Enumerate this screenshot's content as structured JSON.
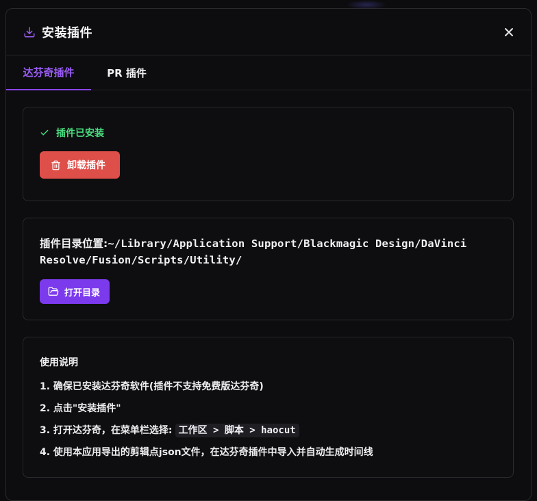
{
  "dialog": {
    "title": "安装插件",
    "title_icon": "download-icon",
    "close_icon": "close-icon"
  },
  "tabs": [
    {
      "label": "达芬奇插件",
      "active": true
    },
    {
      "label": "PR 插件",
      "active": false
    }
  ],
  "status": {
    "text": "插件已安装",
    "icon": "check-icon",
    "color": "#4ade80"
  },
  "uninstall_button": {
    "label": "卸载插件",
    "icon": "trash-icon",
    "color": "#df4f4a"
  },
  "directory": {
    "label": "插件目录位置:",
    "path": "~/Library/Application Support/Blackmagic Design/DaVinci Resolve/Fusion/Scripts/Utility/",
    "open_button_label": "打开目录",
    "open_button_icon": "folder-open-icon",
    "button_color": "#7c3aed"
  },
  "usage": {
    "title": "使用说明",
    "steps": [
      "1. 确保已安装达芬奇软件(插件不支持免费版达芬奇)",
      "2. 点击\"安装插件\"",
      "3. 打开达芬奇，在菜单栏选择:",
      "4. 使用本应用导出的剪辑点json文件，在达芬奇插件中导入并自动生成时间线"
    ],
    "menu_path": "工作区 > 脚本 > haocut"
  },
  "accent_color": "#8b45f2"
}
